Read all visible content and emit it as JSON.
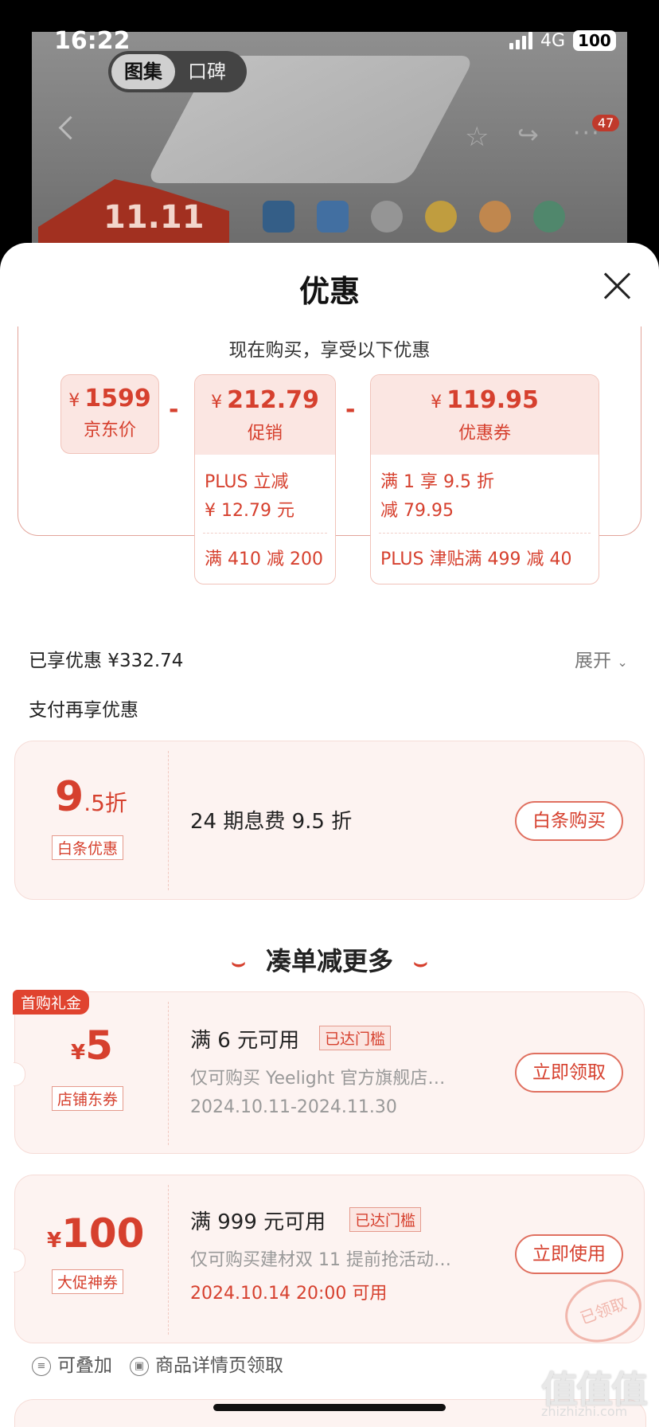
{
  "status_bar": {
    "time": "16:22",
    "network": "4G",
    "battery": "100"
  },
  "background_page": {
    "tabs": [
      "图集",
      "口碑"
    ],
    "badge_count": "47",
    "promo_text": "11.11"
  },
  "sheet": {
    "title": "优惠",
    "discount_subtitle": "现在购买，享受以下优惠",
    "price_items": [
      {
        "currency": "¥",
        "amount": "1599",
        "label": "京东价"
      },
      {
        "currency": "¥",
        "amount": "212.79",
        "label": "促销",
        "details": [
          "PLUS 立减",
          "¥ 12.79 元",
          "满 410 减 200"
        ]
      },
      {
        "currency": "¥",
        "amount": "119.95",
        "label": "优惠券",
        "details": [
          "满 1 享 9.5 折",
          "减 79.95",
          "PLUS 津贴满 499 减 40"
        ]
      }
    ],
    "minus_sign": "-",
    "enjoyed": "已享优惠 ¥332.74",
    "expand": "展开",
    "pay_more": "支付再享优惠",
    "baitiao": {
      "big": "9",
      "small": ".5折",
      "tag": "白条优惠",
      "desc": "24 期息费 9.5 折",
      "button": "白条购买"
    },
    "more_title": "凑单减更多",
    "coupons": [
      {
        "ribbon": "首购礼金",
        "currency": "¥",
        "amount": "5",
        "tag": "店铺东券",
        "title": "满 6 元可用",
        "status": "已达门槛",
        "desc": "仅可购买 Yeelight 官方旗舰店…",
        "date": "2024.10.11-2024.11.30",
        "button": "立即领取"
      },
      {
        "currency": "¥",
        "amount": "100",
        "tag": "大促神券",
        "title": "满 999 元可用",
        "status": "已达门槛",
        "desc": "仅可购买建材双 11 提前抢活动…",
        "date": "2024.10.14 20:00 可用",
        "button": "立即使用",
        "stamp": "已领取"
      }
    ],
    "bottom_notes": [
      "可叠加",
      "商品详情页领取"
    ]
  },
  "watermark": {
    "text": "值值值",
    "sub": "zhizhizhi.com"
  },
  "colors": {
    "accent": "#d6402e",
    "chip_bg": "#fbe6e2",
    "coupon_bg": "#fdf3f1"
  }
}
